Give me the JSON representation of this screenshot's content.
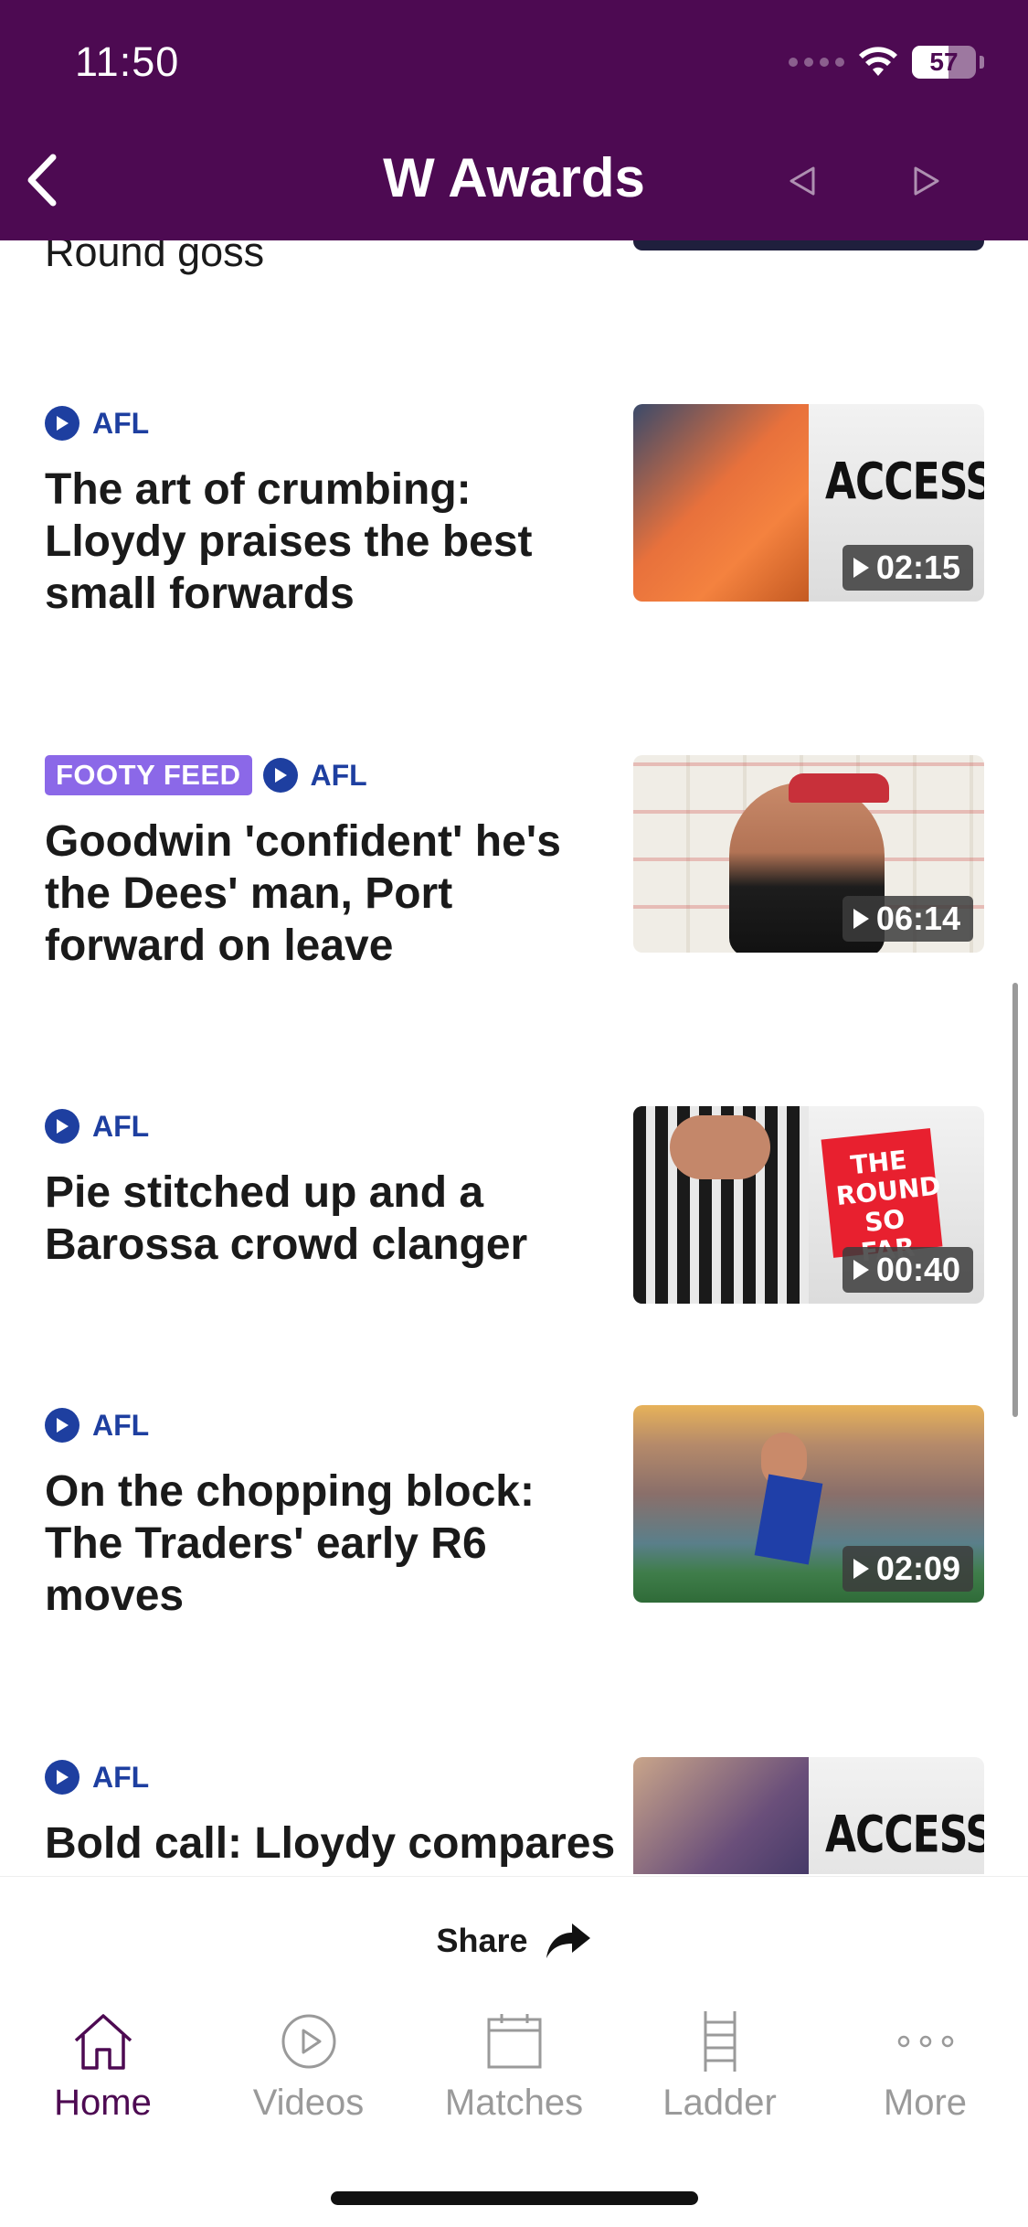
{
  "status_bar": {
    "time": "11:50",
    "battery": "57"
  },
  "header": {
    "title": "W Awards"
  },
  "colors": {
    "header_bg": "#4d0a52",
    "accent_blue": "#1e3fa0",
    "tag_purple": "#8b68e8",
    "tab_active": "#4d0a52",
    "tab_inactive": "#9a9a9a"
  },
  "feed": {
    "partial_title": "Round goss",
    "articles": [
      {
        "tag": "",
        "source": "AFL",
        "headline": "The art of crumbing: Lloydy praises the best small forwards",
        "duration": "02:15",
        "thumb_text": "ACCESS"
      },
      {
        "tag": "FOOTY FEED",
        "source": "AFL",
        "headline": "Goodwin 'confident' he's the Dees' man, Port forward on leave",
        "duration": "06:14",
        "thumb_text": ""
      },
      {
        "tag": "",
        "source": "AFL",
        "headline": "Pie stitched up and a Barossa crowd clanger",
        "duration": "00:40",
        "thumb_text": "THE ROUND SO FAR"
      },
      {
        "tag": "",
        "source": "AFL",
        "headline": "On the chopping block: The Traders' early R6 moves",
        "duration": "02:09",
        "thumb_text": ""
      },
      {
        "tag": "",
        "source": "AFL",
        "headline": "Bold call: Lloydy compares",
        "duration": "",
        "thumb_text": "ACCESS"
      }
    ]
  },
  "share": {
    "label": "Share",
    "icon": "share-arrow-icon"
  },
  "tabs": [
    {
      "label": "Home",
      "icon": "home-icon",
      "active": true
    },
    {
      "label": "Videos",
      "icon": "play-circle-icon",
      "active": false
    },
    {
      "label": "Matches",
      "icon": "calendar-icon",
      "active": false
    },
    {
      "label": "Ladder",
      "icon": "ladder-icon",
      "active": false
    },
    {
      "label": "More",
      "icon": "more-dots-icon",
      "active": false
    }
  ]
}
